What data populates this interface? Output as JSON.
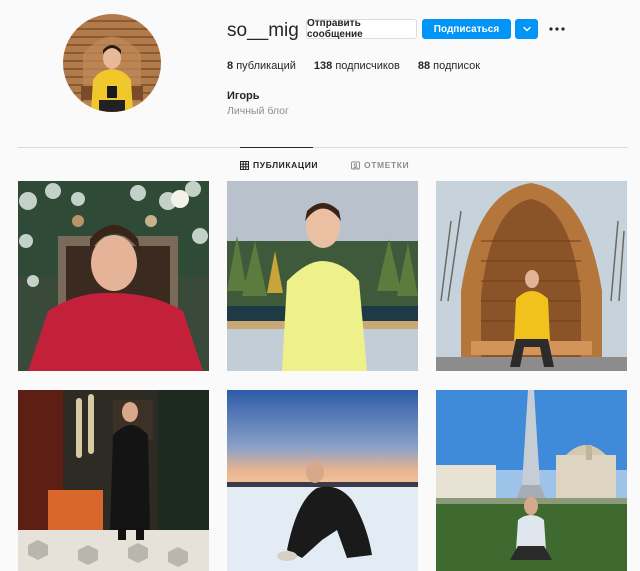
{
  "profile": {
    "username": "so__mig",
    "full_name": "Игорь",
    "bio": "Личный блог",
    "avatar_alt": "avatar"
  },
  "actions": {
    "message_label": "Отправить сообщение",
    "follow_label": "Подписаться",
    "dropdown_icon": "chevron-down-icon",
    "more_icon": "more-horizontal-icon"
  },
  "stats": [
    {
      "count": "8",
      "label": "публикаций"
    },
    {
      "count": "138",
      "label": "подписчиков"
    },
    {
      "count": "88",
      "label": "подписок"
    }
  ],
  "tabs": [
    {
      "label": "ПУБЛИКАЦИИ",
      "icon": "grid-icon",
      "active": true
    },
    {
      "label": "ОТМЕТКИ",
      "icon": "tagged-icon",
      "active": false
    }
  ],
  "colors": {
    "accent": "#0095f6",
    "background": "#fafafa",
    "text": "#262626",
    "muted": "#8e8e8e",
    "border": "#dbdbdb"
  }
}
